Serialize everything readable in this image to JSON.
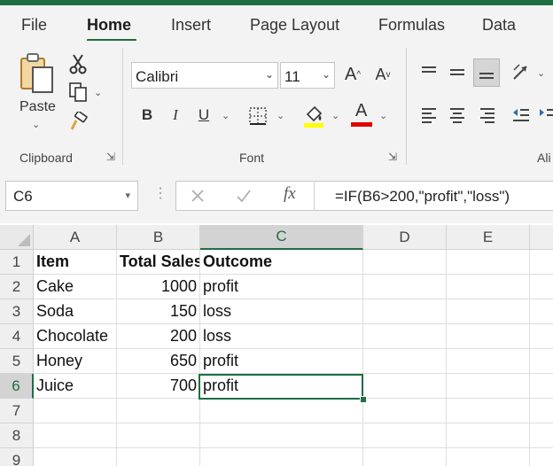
{
  "menu": {
    "tabs": [
      {
        "label": "File"
      },
      {
        "label": "Home"
      },
      {
        "label": "Insert"
      },
      {
        "label": "Page Layout"
      },
      {
        "label": "Formulas"
      },
      {
        "label": "Data"
      }
    ],
    "active_tab": "Home"
  },
  "ribbon": {
    "clipboard": {
      "paste_label": "Paste",
      "group_label": "Clipboard"
    },
    "font": {
      "font_name": "Calibri",
      "font_size": "11",
      "bold": "B",
      "italic": "I",
      "underline": "U",
      "font_color_letter": "A",
      "highlight_color": "#ffff00",
      "font_color": "#e00000",
      "group_label": "Font"
    },
    "alignment": {
      "group_label_partial": "Ali"
    }
  },
  "formula_bar": {
    "name_box": "C6",
    "fx_label": "fx",
    "formula": "=IF(B6>200,\"profit\",\"loss\")"
  },
  "sheet": {
    "columns": [
      "A",
      "B",
      "C",
      "D",
      "E"
    ],
    "rows": [
      "1",
      "2",
      "3",
      "4",
      "5",
      "6",
      "7",
      "8",
      "9"
    ],
    "headers": {
      "a": "Item",
      "b": "Total Sales",
      "c": "Outcome"
    },
    "data": [
      {
        "a": "Cake",
        "b": "1000",
        "c": "profit"
      },
      {
        "a": "Soda",
        "b": "150",
        "c": "loss"
      },
      {
        "a": "Chocolate",
        "b": "200",
        "c": "loss"
      },
      {
        "a": "Honey",
        "b": "650",
        "c": "profit"
      },
      {
        "a": "Juice",
        "b": "700",
        "c": "profit"
      }
    ],
    "selected_cell": "C6",
    "accent_color": "#1e6e42"
  }
}
